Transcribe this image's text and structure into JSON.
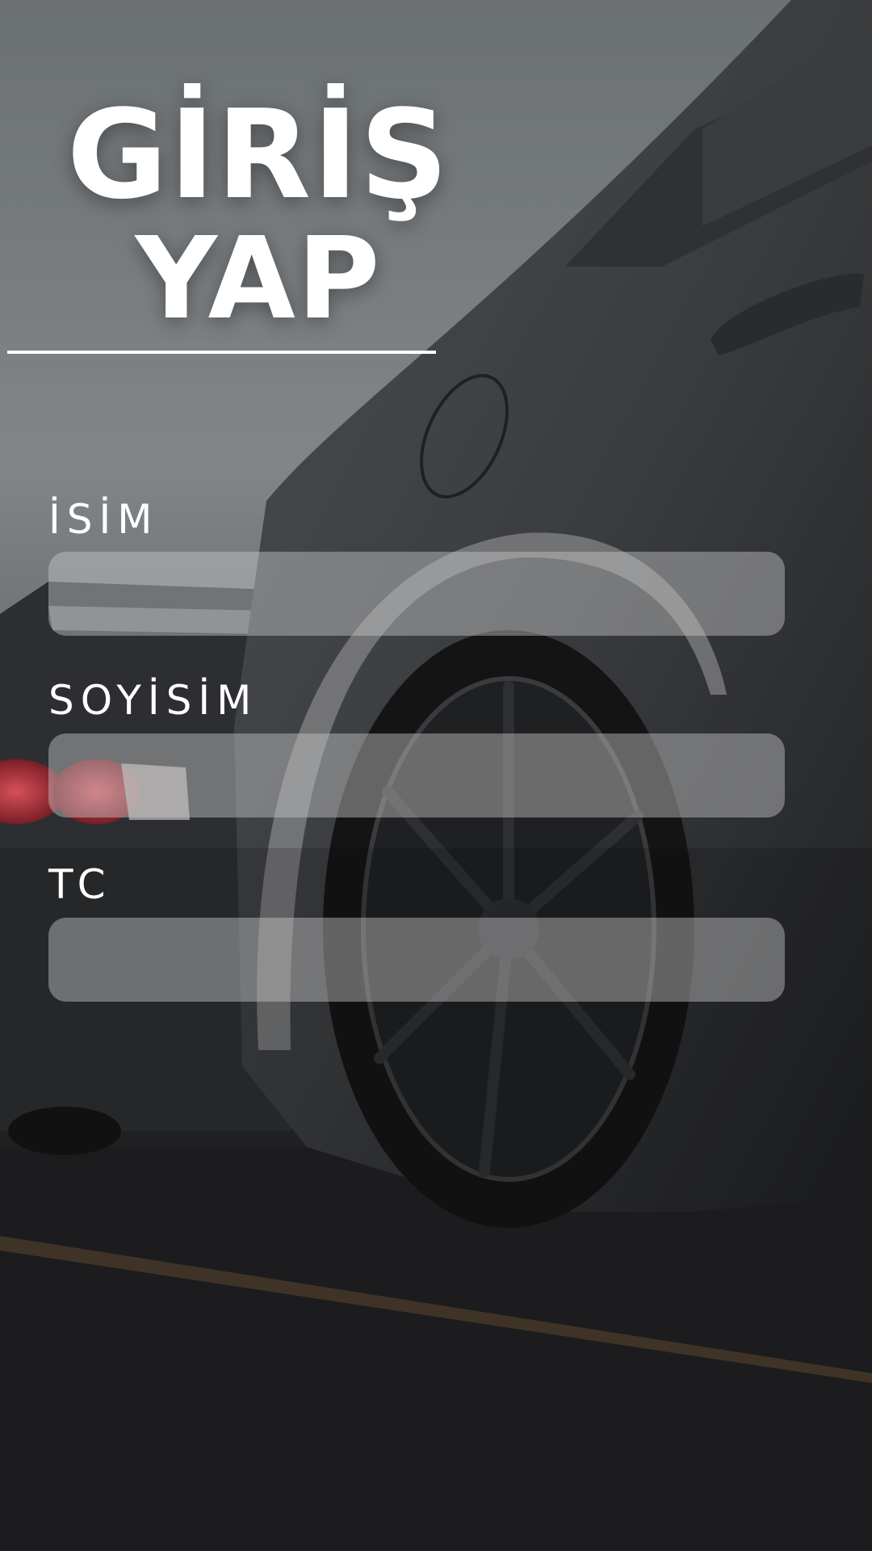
{
  "screen": {
    "title_line1": "GİRİŞ",
    "title_line2": "YAP"
  },
  "form": {
    "fields": [
      {
        "label": "İSİM",
        "value": ""
      },
      {
        "label": "SOYİSİM",
        "value": ""
      },
      {
        "label": "TC",
        "value": ""
      }
    ]
  },
  "colors": {
    "title_text": "#ffffff",
    "field_fill": "rgba(200,200,200,0.45)",
    "background_top": "#74797c",
    "background_bottom": "#1c1c1e"
  }
}
